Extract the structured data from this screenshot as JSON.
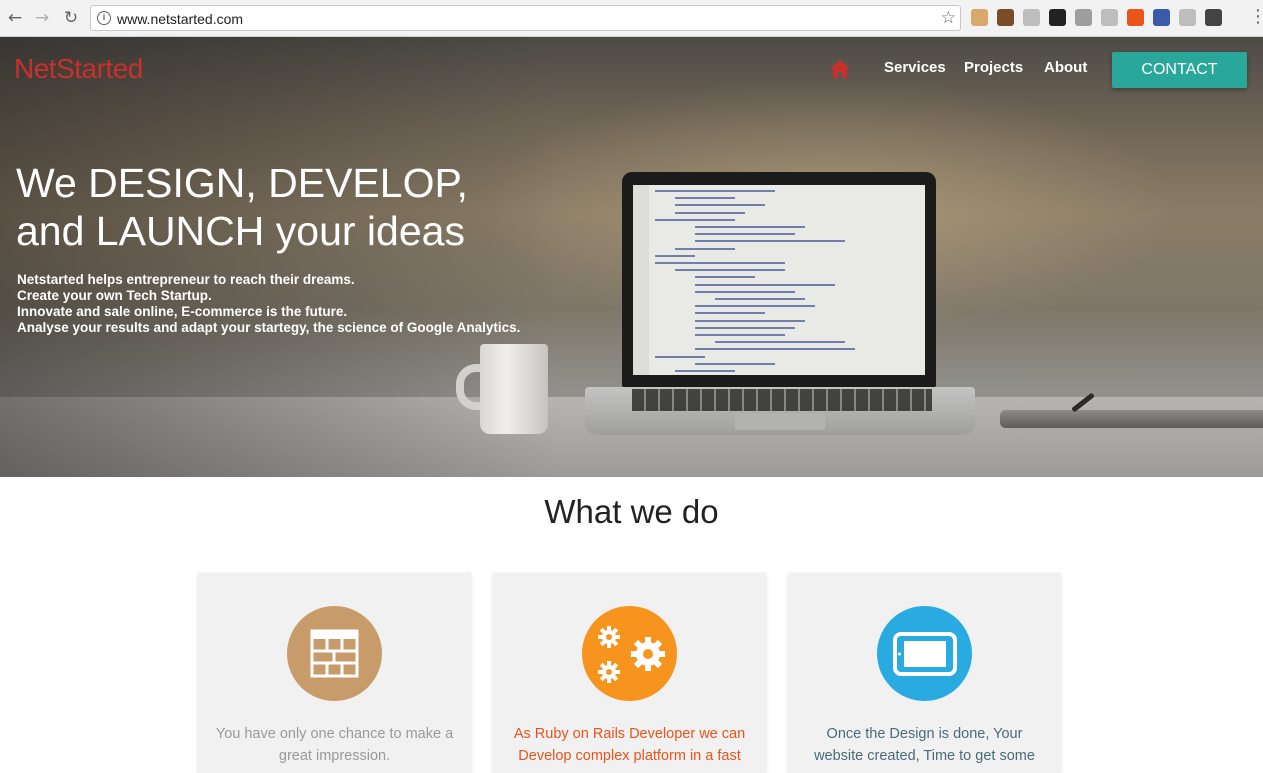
{
  "browser": {
    "url": "www.netstarted.com",
    "icons": [
      "back-icon",
      "forward-icon",
      "reload-icon",
      "info-icon",
      "bookmark-star-icon",
      "menu-dots-icon"
    ],
    "extensions": [
      "#d9a86c",
      "#7a4c2a",
      "#bdbdbd",
      "#222222",
      "#9e9e9e",
      "#bdbdbd",
      "#e8541c",
      "#3b5ba8",
      "#bdbdbd",
      "#444444"
    ]
  },
  "header": {
    "brand": "NetStarted",
    "nav": [
      "Services",
      "Projects",
      "About"
    ],
    "contact": "CONTACT",
    "brand_color": "#c9302c",
    "accent": "#2aa79b"
  },
  "hero": {
    "headline_line1": "We DESIGN, DEVELOP,",
    "headline_line2": "and LAUNCH your ideas",
    "lines": [
      "Netstarted helps entrepreneur to reach their dreams.",
      "Create your own Tech Startup.",
      "Innovate and sale online, E-commerce is the future.",
      "Analyse your results and adapt your startegy, the science of Google Analytics."
    ]
  },
  "services": {
    "title": "What we do",
    "cards": [
      {
        "text": "You have only one chance to make a great impression.",
        "color": "#c89b6a",
        "text_color": "#9a9a9a",
        "icon": "layout-icon"
      },
      {
        "text": "As Ruby on Rails Developer we can Develop complex platform in a fast",
        "color": "#f7941d",
        "text_color": "#e8541c",
        "icon": "gears-icon"
      },
      {
        "text": "Once the Design is done, Your website created, Time to get some",
        "color": "#29abe2",
        "text_color": "#4a6b7a",
        "icon": "tablet-icon"
      }
    ]
  }
}
